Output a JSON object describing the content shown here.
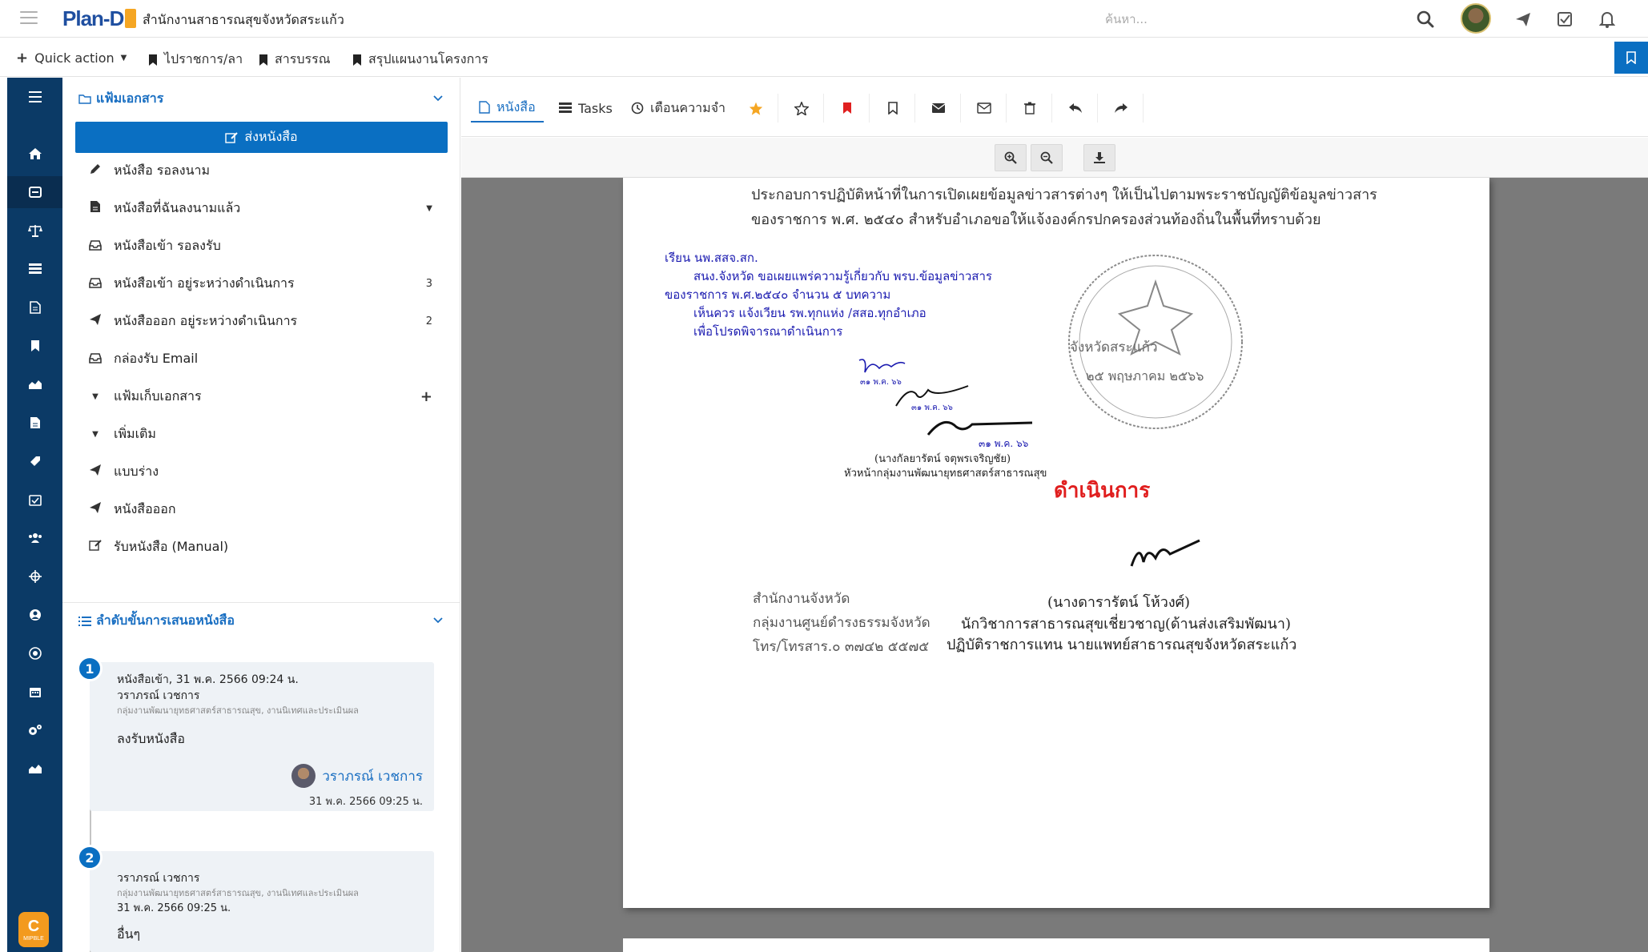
{
  "app": {
    "logo_text": "Plan-D",
    "org_name": "สำนักงานสาธารณสุขจังหวัดสระแก้ว",
    "search_placeholder": "ค้นหา..."
  },
  "quickbar": {
    "quick_action": "Quick action",
    "items": [
      "ไปราชการ/ลา",
      "สารบรรณ",
      "สรุปแผนงานโครงการ"
    ]
  },
  "folder_panel": {
    "title": "แฟ้มเอกสาร",
    "send_button": "ส่งหนังสือ",
    "items": [
      {
        "label": "หนังสือ รอลงนาม",
        "count": "",
        "icon": "pencil-icon"
      },
      {
        "label": "หนังสือที่ฉันลงนามแล้ว",
        "count": "",
        "icon": "file-icon"
      },
      {
        "label": "หนังสือเข้า รอลงรับ",
        "count": "",
        "icon": "inbox-icon"
      },
      {
        "label": "หนังสือเข้า อยู่ระหว่างดำเนินการ",
        "count": "3",
        "icon": "inbox-icon"
      },
      {
        "label": "หนังสือออก อยู่ระหว่างดำเนินการ",
        "count": "2",
        "icon": "send-icon"
      },
      {
        "label": "กล่องรับ Email",
        "count": "",
        "icon": "inbox-icon"
      },
      {
        "label": "แฟ้มเก็บเอกสาร",
        "count": "",
        "icon": "caret-down-icon"
      },
      {
        "label": "เพิ่มเติม",
        "count": "",
        "icon": "caret-down-icon"
      },
      {
        "label": "แบบร่าง",
        "count": "",
        "icon": "send-icon"
      },
      {
        "label": "หนังสือออก",
        "count": "",
        "icon": "send-icon"
      },
      {
        "label": "รับหนังสือ (Manual)",
        "count": "",
        "icon": "edit-icon"
      }
    ]
  },
  "steps": {
    "title": "ลำดับขั้นการเสนอหนังสือ",
    "items": [
      {
        "num": "1",
        "line1": "หนังสือเข้า, 31 พ.ค. 2566 09:24 น.",
        "line2": "วราภรณ์ เวชการ",
        "dept": "กลุ่มงานพัฒนายุทธศาสตร์สาธารณสุข, งานนิเทศและประเมินผล",
        "action": "ลงรับหนังสือ",
        "by": "วราภรณ์ เวชการ",
        "date": "31 พ.ค. 2566 09:25 น."
      },
      {
        "num": "2",
        "line1": "วราภรณ์ เวชการ",
        "dept": "กลุ่มงานพัฒนายุทธศาสตร์สาธารณสุข, งานนิเทศและประเมินผล",
        "date": "31 พ.ค. 2566 09:25 น.",
        "action": "อื่นๆ"
      }
    ]
  },
  "doc_tabs": {
    "letter": "หนังสือ",
    "tasks": "Tasks",
    "reminder": "เตือนความจำ"
  },
  "document": {
    "para1_line1": "ประกอบการปฏิบัติหน้าที่ในการเปิดเผยข้อมูลข่าวสารต่างๆ ให้เป็นไปตามพระราชบัญญัติข้อมูลข่าวสาร",
    "para1_line2": "ของราชการ พ.ศ. ๒๕๔๐ สำหรับอำเภอขอให้แจ้งองค์กรปกครองส่วนท้องถิ่นในพื้นที่ทราบด้วย",
    "note": [
      "เรียน นพ.สสจ.สก.",
      "สนง.จังหวัด ขอเผยแพร่ความรู้เกี่ยวกับ พรบ.ข้อมูลข่าวสาร",
      "ของราชการ พ.ศ.๒๕๔๐ จำนวน ๕ บทความ",
      "เห็นควร แจ้งเวียน รพ.ทุกแห่ง /สสอ.ทุกอำเภอ",
      "เพื่อโปรดพิจารณาดำเนินการ"
    ],
    "sig_date1": "๓๑ พ.ค. ๖๖",
    "sig_date2": "๓๑ พ.ค. ๖๖",
    "sig_date3": "๓๑ พ.ค. ๖๖",
    "signer1": "(นางกัลยารัตน์ จตุพรเจริญชัย)",
    "signer1_title": "หัวหน้ากลุ่มงานพัฒนายุทธศาสตร์สาธารณสุข",
    "stamp": "ดำเนินการ",
    "seal_text1": "จังหวัดสระแก้ว",
    "seal_text2": "๒๕ พฤษภาคม ๒๕๖๖",
    "signer2": "(นางดารารัตน์ โห้วงศ์)",
    "signer2_title1": "นักวิชาการสาธารณสุขเชี่ยวชาญ(ด้านส่งเสริมพัฒนา)",
    "signer2_title2": "ปฏิบัติราชการแทน นายแพทย์สาธารณสุขจังหวัดสระแก้ว",
    "footer1": "สำนักงานจังหวัด",
    "footer2": "กลุ่มงานศูนย์ดำรงธรรมจังหวัด",
    "footer3": "โทร/โทรสาร.๐ ๓๗๔๒ ๕๕๗๕"
  },
  "nav_badge": {
    "letter": "C",
    "label": "MIPBLE"
  },
  "colors": {
    "primary": "#0a6fc2",
    "nav": "#0b3a66",
    "stamp": "#e01e1e",
    "star": "#f5a623",
    "flag": "#e02020"
  }
}
